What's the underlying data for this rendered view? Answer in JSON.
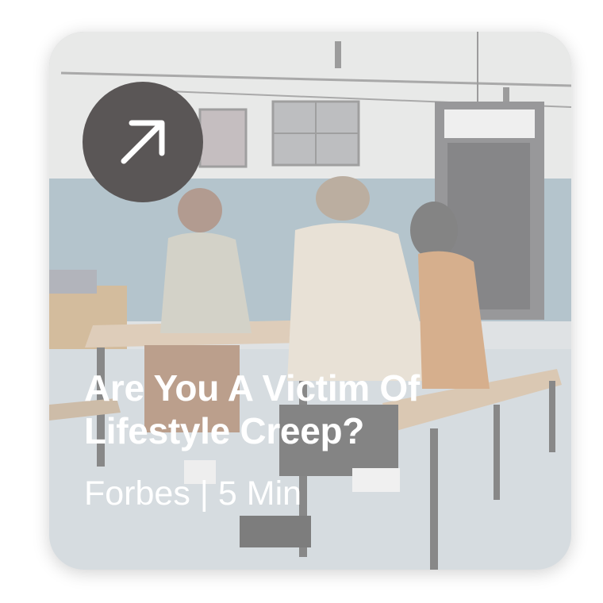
{
  "article": {
    "title": "Are You A Victim Of Lifestyle Creep?",
    "source": "Forbes",
    "separator": "|",
    "read_time": "5 Min"
  },
  "icons": {
    "open": "arrow-up-right-icon"
  },
  "colors": {
    "button_bg": "#5a5656",
    "text": "#ffffff"
  }
}
